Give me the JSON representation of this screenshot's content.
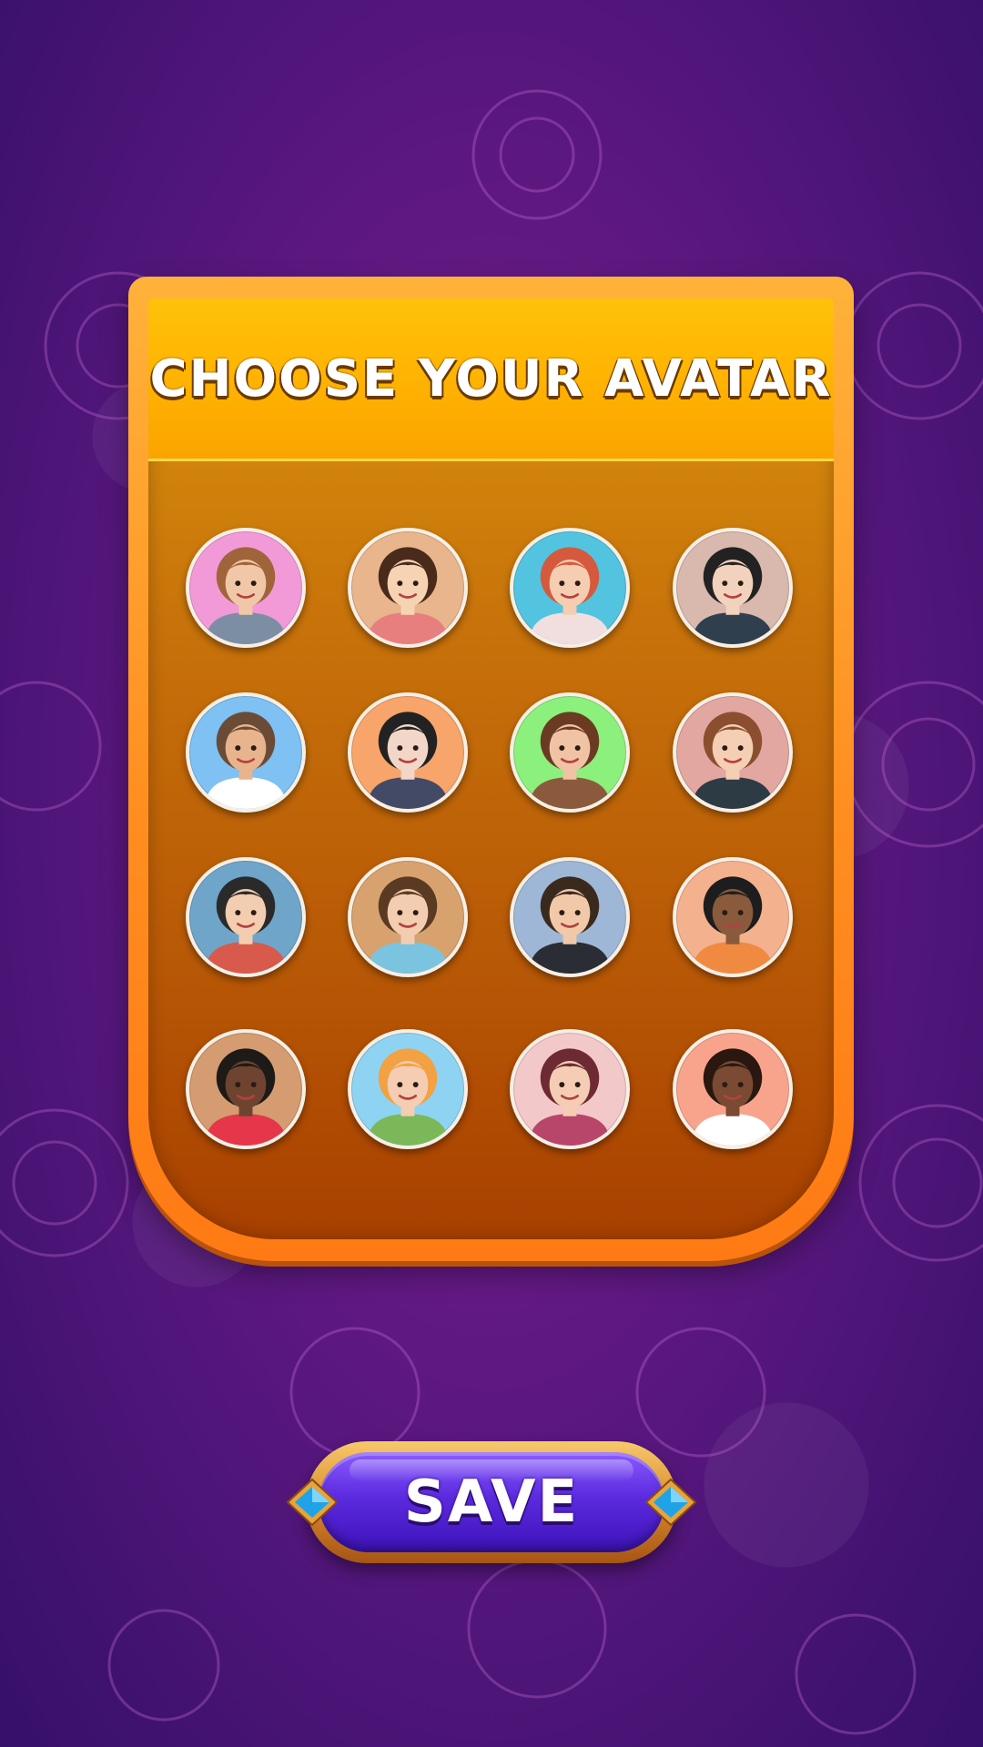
{
  "title": "CHOOSE YOUR AVATAR",
  "save_label": "SAVE",
  "avatars": [
    {
      "name": "avatar-girl-long-hair-pink",
      "bg": "#f29ad8",
      "skin": "#f0c8a8",
      "hair": "#a0643a",
      "shirt": "#7c8ea4"
    },
    {
      "name": "avatar-woman-glasses",
      "bg": "#e9b58c",
      "skin": "#f6d3b3",
      "hair": "#4a2a1a",
      "shirt": "#e87f7f"
    },
    {
      "name": "avatar-woman-red-bob",
      "bg": "#52c4df",
      "skin": "#f5cdb0",
      "hair": "#d55a3d",
      "shirt": "#f1dfe0"
    },
    {
      "name": "avatar-woman-short-black-hair",
      "bg": "#d9b8ad",
      "skin": "#f3d2bd",
      "hair": "#222222",
      "shirt": "#2f3f4e"
    },
    {
      "name": "avatar-girl-braids-sunglasses",
      "bg": "#7ec1f2",
      "skin": "#e7b48d",
      "hair": "#6a4b36",
      "shirt": "#ffffff"
    },
    {
      "name": "avatar-woman-dark-bob",
      "bg": "#f7a56a",
      "skin": "#f2d6c7",
      "hair": "#222222",
      "shirt": "#434a66"
    },
    {
      "name": "avatar-woman-brown-wavy",
      "bg": "#8cf07c",
      "skin": "#f0c3a5",
      "hair": "#6b3a22",
      "shirt": "#8b5a3c"
    },
    {
      "name": "avatar-man-suit-red-tie",
      "bg": "#e2a7a1",
      "skin": "#f4cfb4",
      "hair": "#8b4f2f",
      "shirt": "#2d3b44"
    },
    {
      "name": "avatar-man-bowtie",
      "bg": "#6fa5c9",
      "skin": "#f3cdb0",
      "hair": "#2a2a2a",
      "shirt": "#d85a4c"
    },
    {
      "name": "avatar-man-glasses-blue-shirt",
      "bg": "#d8a26f",
      "skin": "#f3cdb0",
      "hair": "#5a3a22",
      "shirt": "#7ac4e0"
    },
    {
      "name": "avatar-man-beard-suit",
      "bg": "#9fb7d6",
      "skin": "#f1c9a9",
      "hair": "#3a2a1e",
      "shirt": "#2a2d33"
    },
    {
      "name": "avatar-man-curly-hair-tie",
      "bg": "#f3b18e",
      "skin": "#8a5a3c",
      "hair": "#1d1d1d",
      "shirt": "#f08a40"
    },
    {
      "name": "avatar-woman-curly-glasses",
      "bg": "#d49c70",
      "skin": "#6e4430",
      "hair": "#1d1a18",
      "shirt": "#e5364a"
    },
    {
      "name": "avatar-woman-orange-hair",
      "bg": "#8fd3f2",
      "skin": "#f4cdb2",
      "hair": "#f2a143",
      "shirt": "#7bb85a"
    },
    {
      "name": "avatar-woman-short-burgundy",
      "bg": "#f3c8c8",
      "skin": "#f5cdb4",
      "hair": "#6e2a32",
      "shirt": "#b8456a"
    },
    {
      "name": "avatar-woman-afro-curls",
      "bg": "#f8a48c",
      "skin": "#7a4a32",
      "hair": "#2a1810",
      "shirt": "#ffffff"
    }
  ]
}
